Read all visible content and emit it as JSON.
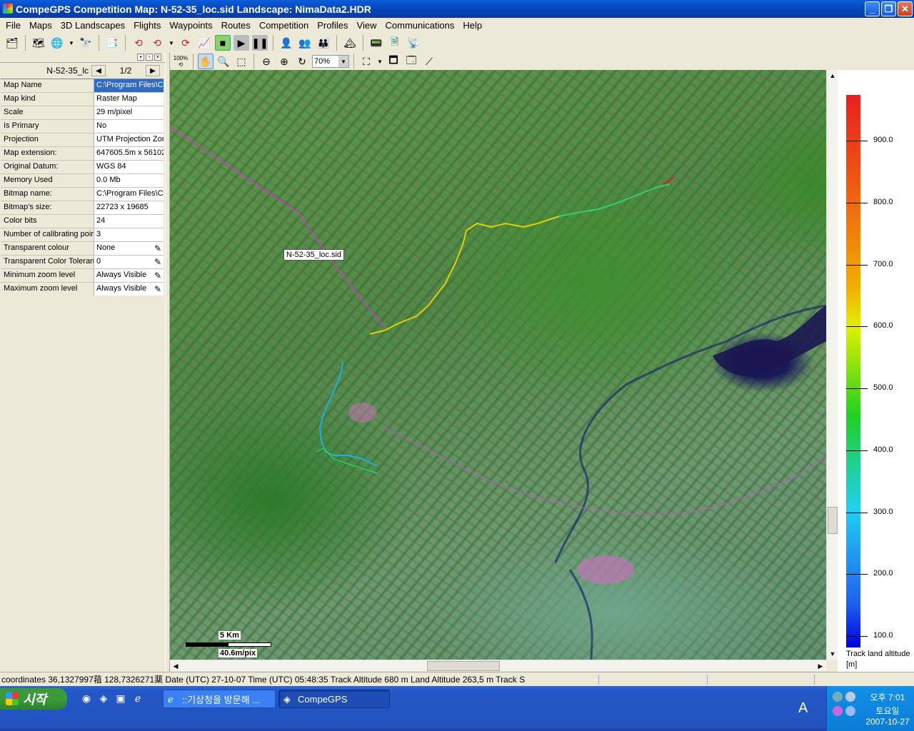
{
  "window": {
    "title": "CompeGPS Competition Map: N-52-35_loc.sid Landscape: NimaData2.HDR",
    "controls": {
      "minimize": "_",
      "maximize": "❐",
      "close": "✕"
    }
  },
  "menu": [
    "File",
    "Maps",
    "3D Landscapes",
    "Flights",
    "Waypoints",
    "Routes",
    "Competition",
    "Profiles",
    "View",
    "Communications",
    "Help"
  ],
  "toolbar2": {
    "zoom_value": "70%",
    "zoom100": "100%"
  },
  "left_panel": {
    "map_selector": "N-52-35_lc",
    "page": "1/2",
    "properties": [
      {
        "key": "Map Name",
        "value": "C:\\Program Files\\Co",
        "selected": true,
        "editable": false
      },
      {
        "key": "Map kind",
        "value": "Raster Map",
        "selected": false,
        "editable": false
      },
      {
        "key": "Scale",
        "value": "29 m/pixel",
        "selected": false,
        "editable": false
      },
      {
        "key": "Is Primary",
        "value": "No",
        "selected": false,
        "editable": false
      },
      {
        "key": "Projection",
        "value": "UTM Projection Zor",
        "selected": false,
        "editable": false
      },
      {
        "key": "Map extension:",
        "value": "647605.5m x 56102",
        "selected": false,
        "editable": false
      },
      {
        "key": "Original Datum:",
        "value": "WGS 84",
        "selected": false,
        "editable": false
      },
      {
        "key": "Memory Used",
        "value": "0.0 Mb",
        "selected": false,
        "editable": false
      },
      {
        "key": "Bitmap name:",
        "value": "C:\\Program Files\\Co",
        "selected": false,
        "editable": false
      },
      {
        "key": "Bitmap's size:",
        "value": "22723 x 19685",
        "selected": false,
        "editable": false
      },
      {
        "key": "Color bits",
        "value": "24",
        "selected": false,
        "editable": false
      },
      {
        "key": "Number of calibrating point",
        "value": "3",
        "selected": false,
        "editable": false
      },
      {
        "key": "Transparent colour",
        "value": "None",
        "selected": false,
        "editable": true
      },
      {
        "key": "Transparent Color Toleranc",
        "value": "0",
        "selected": false,
        "editable": true
      },
      {
        "key": "Minimum zoom level",
        "value": "Always Visible",
        "selected": false,
        "editable": true
      },
      {
        "key": "Maximum zoom level",
        "value": "Always Visible",
        "selected": false,
        "editable": true
      }
    ]
  },
  "map": {
    "label": "N-52-35_loc.sid",
    "scale_distance": "5 Km",
    "scale_resolution": "40.6m/pix"
  },
  "legend": {
    "ticks": [
      "900.0",
      "800.0",
      "700.0",
      "600.0",
      "500.0",
      "400.0",
      "300.0",
      "200.0",
      "100.0"
    ],
    "title_line1": "Track land altitude",
    "title_line2": "[m]",
    "colors": [
      "#e82020",
      "#f0b000",
      "#e0f000",
      "#20d020",
      "#20d0f0",
      "#2060f0",
      "#0000e0"
    ]
  },
  "status": {
    "text": "coordinates 36,1327997䔃 128,7326271䕁 Date (UTC) 27-10-07 Time (UTC) 05:48:35 Track Altitude 680 m Land Altitude 263,5 m Track S"
  },
  "taskbar": {
    "start_label": "시작",
    "tasks": [
      {
        "label": "::기상청을 방문해 ...",
        "active": false
      },
      {
        "label": "CompeGPS",
        "active": true
      }
    ],
    "ime": "A",
    "clock": {
      "ampm_time": "오후 7:01",
      "weekday": "토요일",
      "date": "2007-10-27"
    }
  }
}
